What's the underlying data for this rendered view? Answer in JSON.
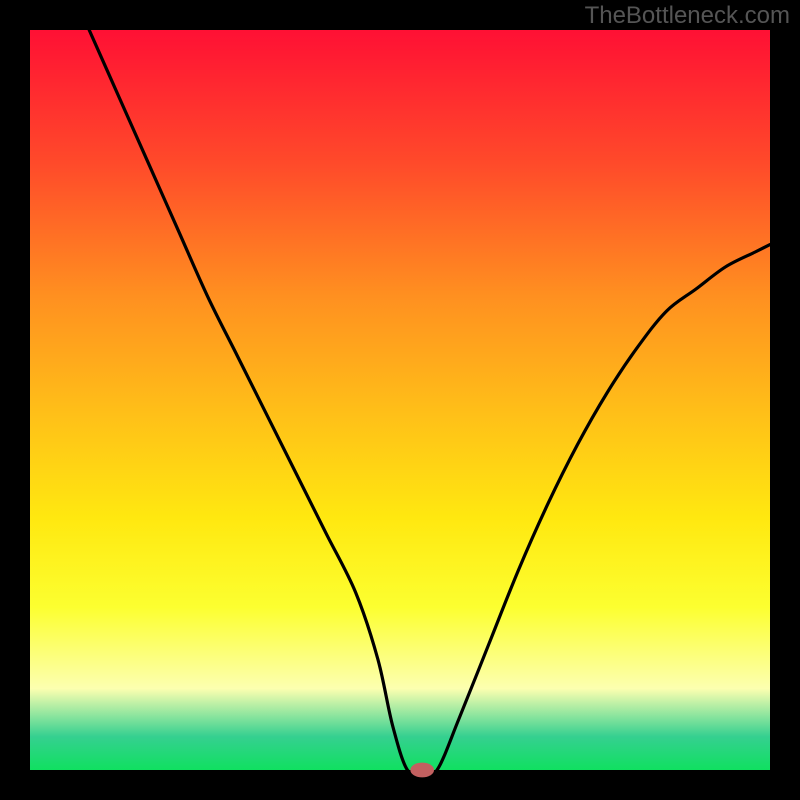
{
  "watermark": "TheBottleneck.com",
  "colors": {
    "frame": "#000000",
    "gradient_top": "#ff1034",
    "gradient_upper": "#ff4a2a",
    "gradient_mid_upper": "#ff9020",
    "gradient_mid": "#ffc018",
    "gradient_mid_lower": "#ffe810",
    "gradient_lower": "#fcff30",
    "gradient_light": "#fcffb0",
    "gradient_teal": "#35d090",
    "gradient_green": "#10e060",
    "curve": "#000000",
    "marker": "#c26060"
  },
  "chart_data": {
    "type": "line",
    "title": "",
    "xlabel": "",
    "ylabel": "",
    "xlim": [
      0,
      100
    ],
    "ylim": [
      0,
      100
    ],
    "series": [
      {
        "name": "curve",
        "x": [
          8,
          12,
          16,
          20,
          24,
          28,
          32,
          36,
          40,
          44,
          47,
          49,
          51,
          53,
          55,
          58,
          62,
          66,
          70,
          74,
          78,
          82,
          86,
          90,
          94,
          98,
          100
        ],
        "y": [
          100,
          91,
          82,
          73,
          64,
          56,
          48,
          40,
          32,
          24,
          15,
          6,
          0,
          0,
          0,
          7,
          17,
          27,
          36,
          44,
          51,
          57,
          62,
          65,
          68,
          70,
          71
        ]
      }
    ],
    "marker": {
      "x": 53,
      "y": 0,
      "rx": 1.6,
      "ry": 1.0
    }
  }
}
